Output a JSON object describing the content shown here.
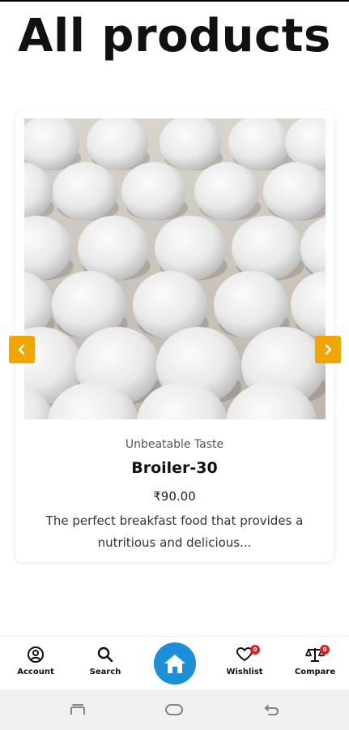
{
  "page": {
    "title": "All products"
  },
  "product": {
    "image_subject": "white eggs in tray",
    "tagline": "Unbeatable Taste",
    "name": "Broiler-30",
    "price": "₹90.00",
    "description": "The perfect breakfast food that provides a nutritious and delicious..."
  },
  "carousel": {
    "prev_icon": "chevron-left-icon",
    "next_icon": "chevron-right-icon",
    "accent_color": "#f0a500"
  },
  "bottom_nav": {
    "account_label": "Account",
    "search_label": "Search",
    "home_icon": "home-icon",
    "wishlist_label": "Wishlist",
    "wishlist_count": "0",
    "compare_label": "Compare",
    "compare_count": "0",
    "home_color": "#1d8fd8",
    "badge_color": "#e02020"
  },
  "system_nav": {
    "icons": [
      "recent-apps-icon",
      "home-pill-icon",
      "back-icon"
    ]
  }
}
